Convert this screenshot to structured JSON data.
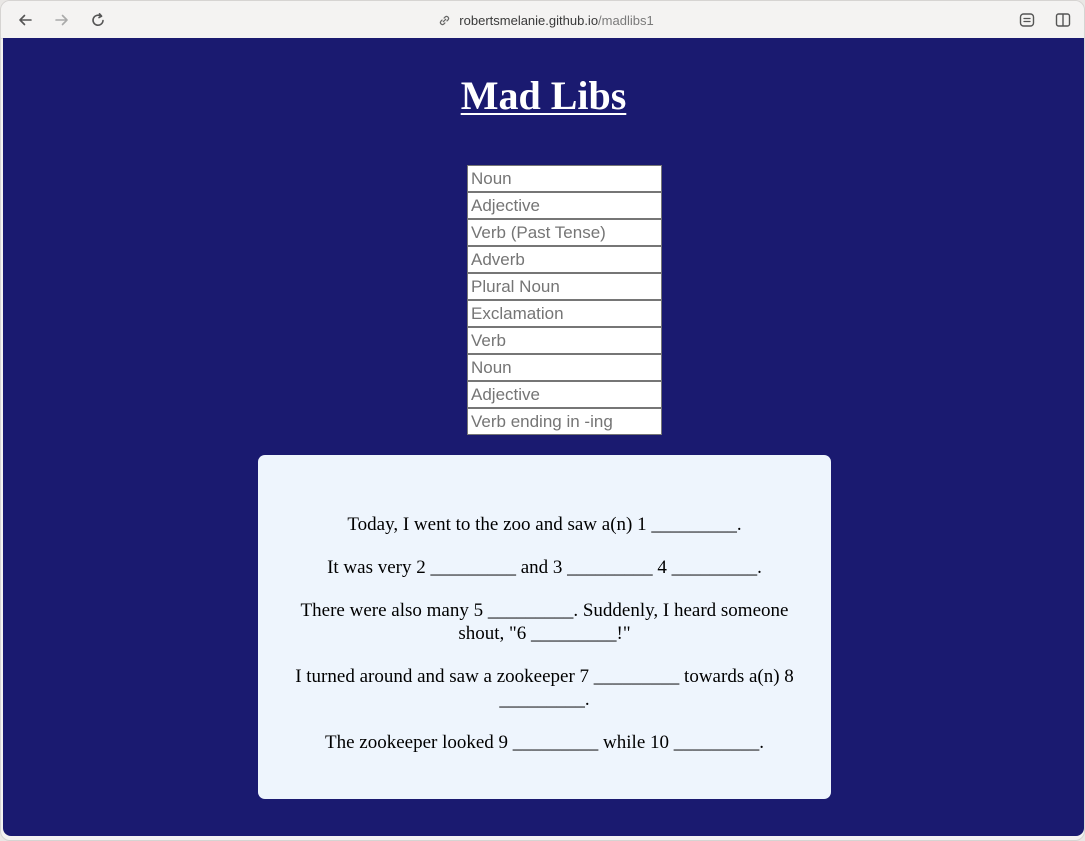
{
  "browser": {
    "url_host": "robertsmelanie.github.io",
    "url_path": "/madlibs1"
  },
  "page": {
    "title": "Mad Libs"
  },
  "inputs": [
    {
      "placeholder": "Noun"
    },
    {
      "placeholder": "Adjective"
    },
    {
      "placeholder": "Verb (Past Tense)"
    },
    {
      "placeholder": "Adverb"
    },
    {
      "placeholder": "Plural Noun"
    },
    {
      "placeholder": "Exclamation"
    },
    {
      "placeholder": "Verb"
    },
    {
      "placeholder": "Noun"
    },
    {
      "placeholder": "Adjective"
    },
    {
      "placeholder": "Verb ending in -ing"
    }
  ],
  "story": {
    "lines": [
      "Today, I went to the zoo and saw a(n) 1 _________.",
      "It was very 2 _________ and 3 _________ 4 _________.",
      "There were also many 5 _________. Suddenly, I heard someone shout, \"6 _________!\"",
      "I turned around and saw a zookeeper 7 _________ towards a(n) 8 _________.",
      "The zookeeper looked 9 _________ while 10 _________."
    ]
  },
  "colors": {
    "background": "#1a1a70",
    "story_bg": "#eef5fd",
    "title": "#ffffff"
  }
}
